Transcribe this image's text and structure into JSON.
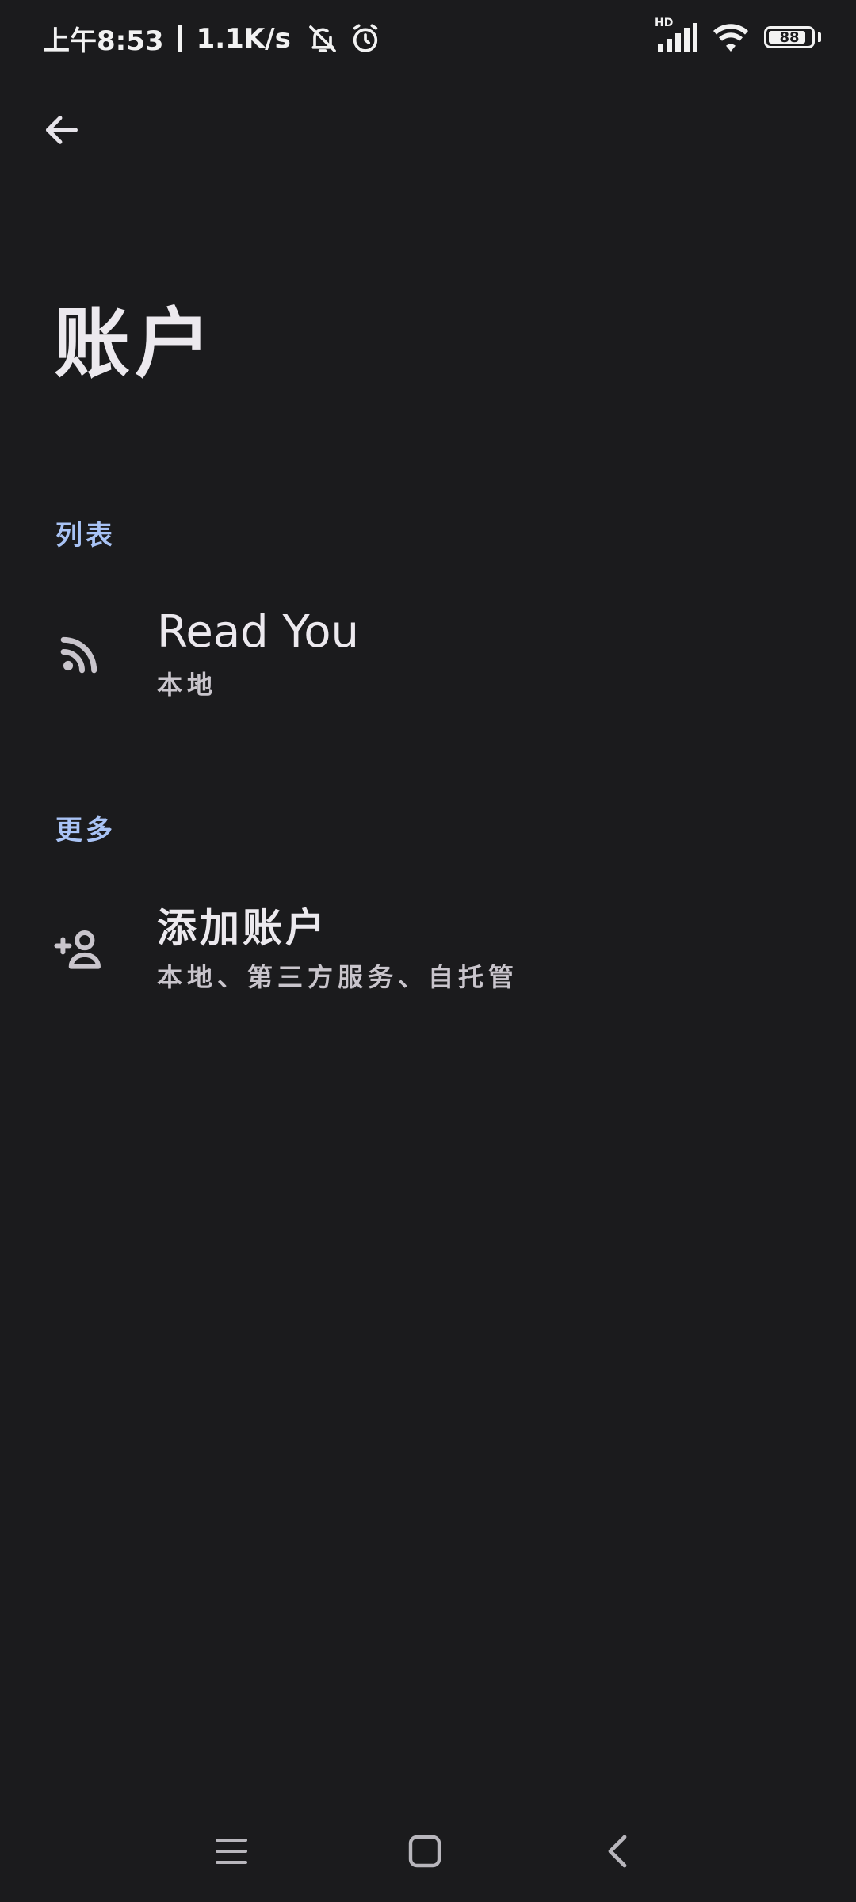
{
  "status_bar": {
    "time": "上午8:53",
    "network_speed": "1.1K/s",
    "signal_label": "HD",
    "battery_level": "88",
    "battery_fraction": 0.88
  },
  "header": {
    "title": "账户"
  },
  "sections": [
    {
      "header": "列表",
      "items": [
        {
          "title": "Read You",
          "subtitle": "本地",
          "icon": "rss-icon"
        }
      ]
    },
    {
      "header": "更多",
      "items": [
        {
          "title": "添加账户",
          "subtitle": "本地、第三方服务、自托管",
          "icon": "add-person-icon"
        }
      ]
    }
  ],
  "colors": {
    "background": "#1b1b1d",
    "accent": "#a9c3f5",
    "text_primary": "#ece9ee",
    "text_secondary": "#c9c5cc"
  }
}
